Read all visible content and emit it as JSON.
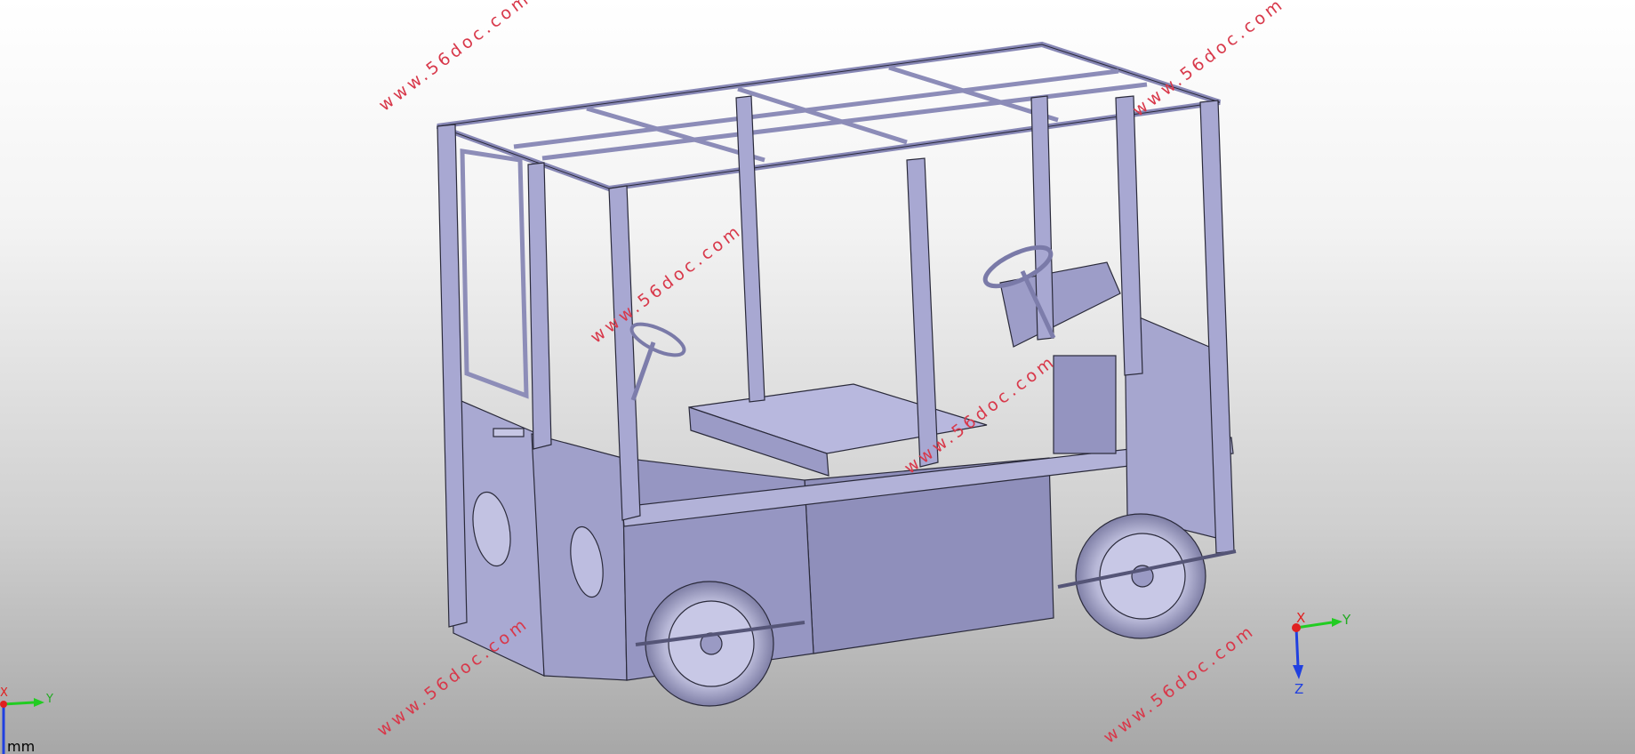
{
  "viewer": {
    "watermark_text": "www.56doc.com",
    "units_label": "mm",
    "background_gradient": [
      "#ffffff",
      "#a7a7a7"
    ],
    "model_color": "#9c9cc6"
  },
  "triad_main": {
    "x_label": "X",
    "y_label": "Y",
    "z_label": "Z",
    "x_color": "#e02020",
    "y_color": "#22cc22",
    "z_color": "#2040e0"
  },
  "triad_corner": {
    "x_label": "X",
    "y_label": "Y"
  }
}
